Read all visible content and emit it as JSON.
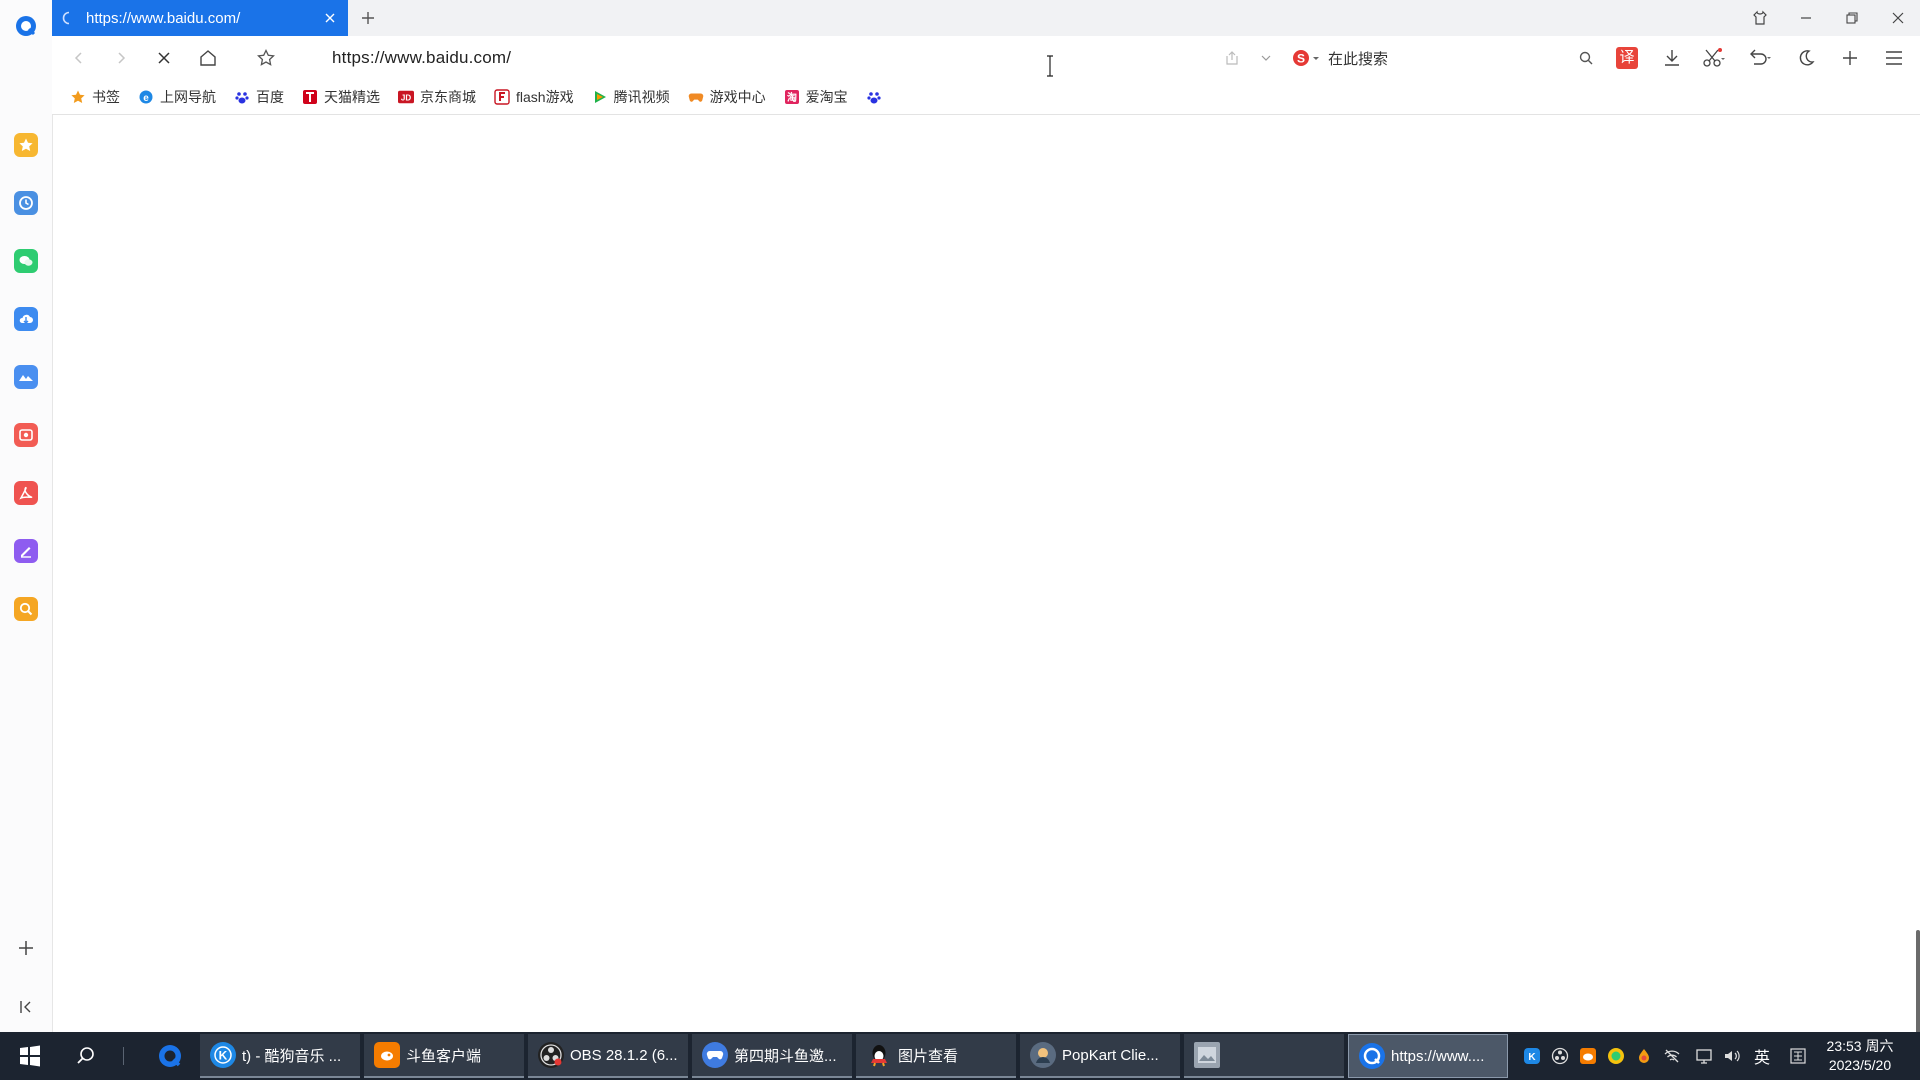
{
  "tab": {
    "title": "https://www.baidu.com/",
    "new_tab_label": "+"
  },
  "address": {
    "url": "https://www.baidu.com/"
  },
  "search": {
    "placeholder": "在此搜索"
  },
  "toolbar": {
    "translate_label": "译"
  },
  "bookmarks": [
    {
      "label": "书签",
      "icon": "star-icon"
    },
    {
      "label": "上网导航",
      "icon": "ie-icon"
    },
    {
      "label": "百度",
      "icon": "baidu-paw-icon"
    },
    {
      "label": "天猫精选",
      "icon": "tmall-icon"
    },
    {
      "label": "京东商城",
      "icon": "jd-icon"
    },
    {
      "label": "flash游戏",
      "icon": "flash-icon"
    },
    {
      "label": "腾讯视频",
      "icon": "tencent-video-icon"
    },
    {
      "label": "游戏中心",
      "icon": "gamepad-icon"
    },
    {
      "label": "爱淘宝",
      "icon": "taobao-icon"
    },
    {
      "label": "",
      "icon": "baidu-paw-icon"
    }
  ],
  "sidebar_apps": [
    "favorites-icon",
    "history-icon",
    "wechat-icon",
    "cloud-icon",
    "mountain-icon",
    "photo-icon",
    "pdf-icon",
    "notes-icon",
    "search-app-icon"
  ],
  "taskbar": {
    "tasks": [
      {
        "label": "t) - 酷狗音乐 ...",
        "icon": "kugou-icon",
        "color": "#1e88e5"
      },
      {
        "label": "斗鱼客户端",
        "icon": "douyu-icon",
        "color": "#f57c00"
      },
      {
        "label": "OBS 28.1.2 (6...",
        "icon": "obs-icon",
        "color": "#222222"
      },
      {
        "label": "第四期斗鱼邀...",
        "icon": "game-icon",
        "color": "#3f7be0"
      },
      {
        "label": "图片查看",
        "icon": "qq-icon",
        "color": "#111111"
      },
      {
        "label": "PopKart Clie...",
        "icon": "popkart-icon",
        "color": "#5a6b80"
      },
      {
        "label": "",
        "icon": "image-thumb-icon",
        "color": "#9aa4b0"
      },
      {
        "label": "https://www....",
        "icon": "browser-icon",
        "color": "#1a73e8"
      }
    ],
    "ime_label": "英",
    "time": "23:53 周六",
    "date": "2023/5/20"
  },
  "colors": {
    "accent": "#1a73e8",
    "taskbar": "#1c2430"
  }
}
